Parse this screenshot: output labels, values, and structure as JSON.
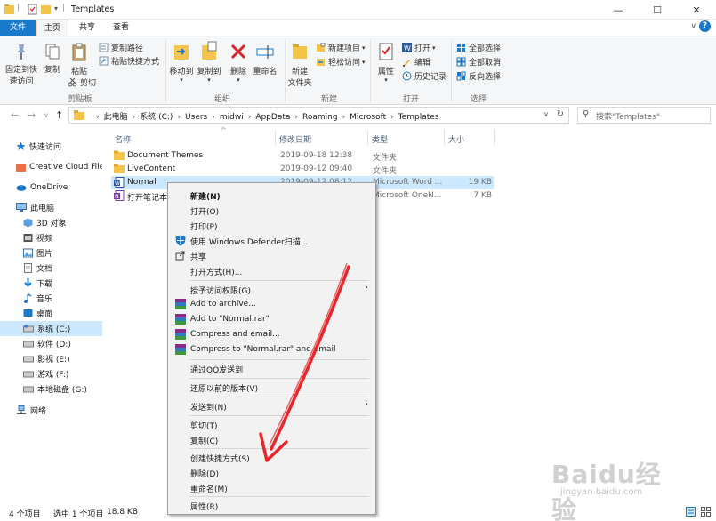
{
  "window": {
    "title": "Templates",
    "controls": {
      "minimize": "—",
      "maximize": "☐",
      "close": "✕"
    }
  },
  "ribbon_tabs": {
    "file": "文件",
    "home": "主页",
    "share": "共享",
    "view": "查看"
  },
  "ribbon": {
    "pin_quick_access": "固定到快",
    "pin_quick_access2": "速访问",
    "copy": "复制",
    "paste": "粘贴",
    "copy_path": "复制路径",
    "paste_shortcut": "粘贴快捷方式",
    "cut": "剪切",
    "group_clipboard": "剪贴板",
    "move_to": "移动到",
    "copy_to": "复制到",
    "delete": "删除",
    "rename": "重命名",
    "group_organize": "组织",
    "new_folder": "新建",
    "new_folder2": "文件夹",
    "new_item": "新建项目",
    "easy_access": "轻松访问",
    "group_new": "新建",
    "properties": "属性",
    "open": "打开",
    "edit": "编辑",
    "history": "历史记录",
    "group_open": "打开",
    "select_all": "全部选择",
    "select_none": "全部取消",
    "invert_selection": "反向选择",
    "group_select": "选择"
  },
  "address": {
    "crumbs": [
      "此电脑",
      "系统 (C:)",
      "Users",
      "midwi",
      "AppData",
      "Roaming",
      "Microsoft",
      "Templates"
    ],
    "search_placeholder": "搜索\"Templates\""
  },
  "navpane": {
    "items": [
      {
        "label": "快速访问"
      },
      {
        "label": "Creative Cloud Files"
      },
      {
        "label": "OneDrive"
      },
      {
        "label": "此电脑"
      },
      {
        "label": "3D 对象"
      },
      {
        "label": "视频"
      },
      {
        "label": "图片"
      },
      {
        "label": "文档"
      },
      {
        "label": "下载"
      },
      {
        "label": "音乐"
      },
      {
        "label": "桌面"
      },
      {
        "label": "系统 (C:)"
      },
      {
        "label": "软件 (D:)"
      },
      {
        "label": "影视 (E:)"
      },
      {
        "label": "游戏 (F:)"
      },
      {
        "label": "本地磁盘 (G:)"
      },
      {
        "label": "网络"
      }
    ]
  },
  "filelist": {
    "columns": {
      "name": "名称",
      "date": "修改日期",
      "type": "类型",
      "size": "大小"
    },
    "rows": [
      {
        "name": "Document Themes",
        "date": "2019-09-18 12:38",
        "type": "文件夹",
        "size": ""
      },
      {
        "name": "LiveContent",
        "date": "2019-09-12 09:40",
        "type": "文件夹",
        "size": ""
      },
      {
        "name": "Normal",
        "date": "2019-09-12 08:12",
        "type": "Microsoft Word ...",
        "size": "19 KB"
      },
      {
        "name": "打开笔记本",
        "date": "",
        "type": "Microsoft OneN...",
        "size": "7 KB"
      }
    ]
  },
  "statusbar": {
    "count": "4 个项目",
    "selected": "选中 1 个项目",
    "size": "18.8 KB"
  },
  "context_menu": {
    "items": [
      {
        "label": "新建(N)"
      },
      {
        "label": "打开(O)"
      },
      {
        "label": "打印(P)"
      },
      {
        "label": "使用 Windows Defender扫描..."
      },
      {
        "label": "共享"
      },
      {
        "label": "打开方式(H)..."
      },
      {
        "label": "授予访问权限(G)"
      },
      {
        "label": "Add to archive..."
      },
      {
        "label": "Add to \"Normal.rar\""
      },
      {
        "label": "Compress and email..."
      },
      {
        "label": "Compress to \"Normal.rar\" and email"
      },
      {
        "label": "通过QQ发送到"
      },
      {
        "label": "还原以前的版本(V)"
      },
      {
        "label": "发送到(N)"
      },
      {
        "label": "剪切(T)"
      },
      {
        "label": "复制(C)"
      },
      {
        "label": "创建快捷方式(S)"
      },
      {
        "label": "删除(D)"
      },
      {
        "label": "重命名(M)"
      },
      {
        "label": "属性(R)"
      }
    ]
  },
  "watermark": {
    "brand": "Baidu经验",
    "url": "jingyan.baidu.com"
  },
  "colors": {
    "accent": "#1979ca",
    "selection": "#cce8ff",
    "folder": "#f3c54a",
    "arrow": "#e8262b"
  }
}
